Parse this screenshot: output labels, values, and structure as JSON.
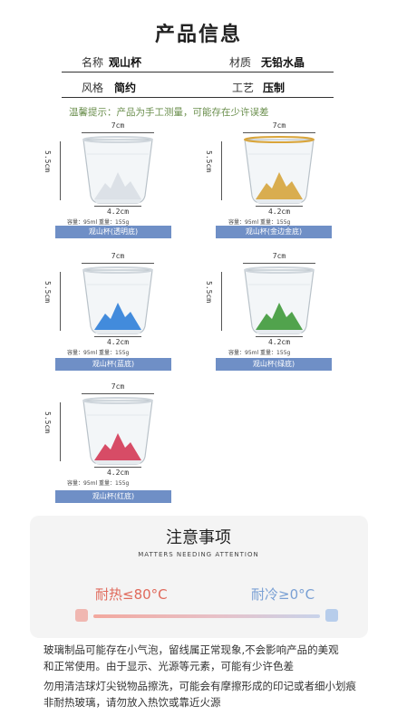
{
  "title": "产品信息",
  "specs": [
    {
      "label": "名称",
      "value": "观山杯"
    },
    {
      "label": "材质",
      "value": "无铅水晶"
    },
    {
      "label": "风格",
      "value": "简约"
    },
    {
      "label": "工艺",
      "value": "压制"
    }
  ],
  "tip": "温馨提示：产品为手工测量，可能存在少许误差",
  "dims": {
    "width": "7cm",
    "height": "5.5cm",
    "base": "4.2cm"
  },
  "spec_text": "容量：95ml     重量：155g",
  "products": [
    {
      "name": "观山杯(透明底)",
      "base_color": "#d9dfe4",
      "rim_color": "#cfd6dc"
    },
    {
      "name": "观山杯(金边金底)",
      "base_color": "#d6a53c",
      "rim_color": "#d9a53a"
    },
    {
      "name": "观山杯(蓝底)",
      "base_color": "#2f7fd8",
      "rim_color": "#cfd6dc"
    },
    {
      "name": "观山杯(绿底)",
      "base_color": "#3f9a3a",
      "rim_color": "#cfd6dc"
    },
    {
      "name": "观山杯(红底)",
      "base_color": "#d43a55",
      "rim_color": "#cfd6dc"
    }
  ],
  "attention": {
    "title": "注意事项",
    "subtitle": "MATTERS NEEDING ATTENTION",
    "hot": "耐热≤80°C",
    "cold": "耐冷≥0°C"
  },
  "notes": [
    "玻璃制品可能存在小气泡，留线属正常现象,不会影响产品的美观",
    "和正常使用。由于显示、光源等元素，可能有少许色差",
    "勿用清洁球灯尖锐物品擦洗，可能会有摩擦形成的印记或者细小划痕",
    "非耐热玻璃，请勿放入热饮或靠近火源"
  ]
}
